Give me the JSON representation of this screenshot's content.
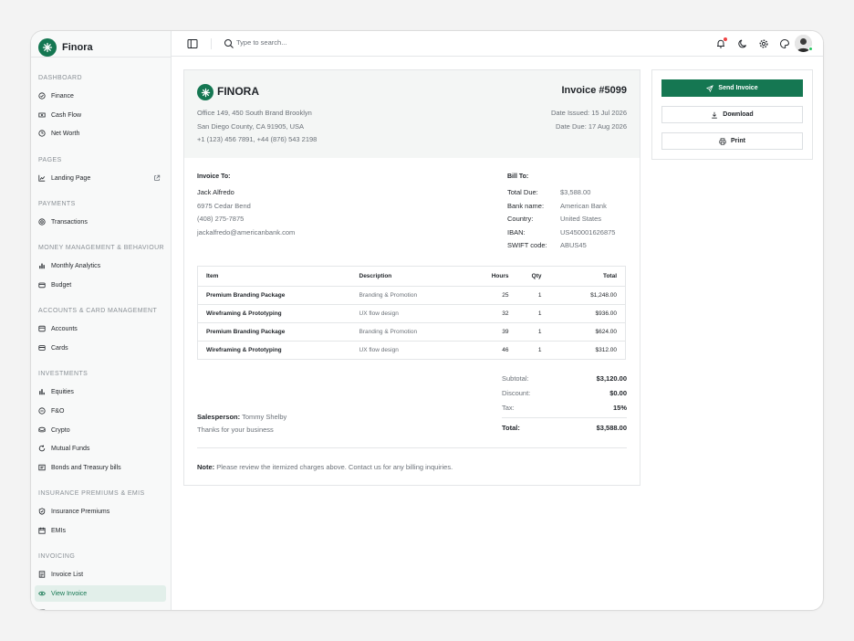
{
  "app": {
    "name": "Finora"
  },
  "sidebar": {
    "sections": {
      "dashboard": "DASHBOARD",
      "pages": "PAGES",
      "payments": "PAYMENTS",
      "money": "MONEY MANAGEMENT & BEHAVIOUR",
      "accounts": "ACCOUNTS & CARD MANAGEMENT",
      "investments": "INVESTMENTS",
      "insurance": "INSURANCE PREMIUMS & EMIS",
      "invoicing": "INVOICING"
    },
    "items": {
      "finance": "Finance",
      "cash_flow": "Cash Flow",
      "net_worth": "Net Worth",
      "landing_page": "Landing Page",
      "transactions": "Transactions",
      "monthly_analytics": "Monthly Analytics",
      "budget": "Budget",
      "accounts": "Accounts",
      "cards": "Cards",
      "equities": "Equities",
      "fo": "F&O",
      "crypto": "Crypto",
      "mutual_funds": "Mutual Funds",
      "bonds": "Bonds and Treasury bills",
      "insurance_premiums": "Insurance Premiums",
      "emis": "EMIs",
      "invoice_list": "Invoice List",
      "view_invoice": "View Invoice"
    },
    "active": "View Invoice"
  },
  "topbar": {
    "search_placeholder": "Type to search..."
  },
  "invoice": {
    "company": "FINORA",
    "number": "Invoice #5099",
    "address": [
      "Office 149, 450 South Brand Brooklyn",
      "San Diego County, CA 91905, USA",
      "+1 (123) 456 7891, +44 (876) 543 2198"
    ],
    "date_issued": "Date Issued: 15 Jul 2026",
    "date_due": "Date Due: 17 Aug 2026",
    "invoice_to": {
      "label": "Invoice To:",
      "name": "Jack Alfredo",
      "street": "6975 Cedar Bend",
      "phone": "(408) 275-7875",
      "email": "jackalfredo@americanbank.com"
    },
    "bill_to": {
      "label": "Bill To:",
      "rows": [
        {
          "k": "Total Due:",
          "v": "$3,588.00"
        },
        {
          "k": "Bank name:",
          "v": "American Bank"
        },
        {
          "k": "Country:",
          "v": "United States"
        },
        {
          "k": "IBAN:",
          "v": "US450001626875"
        },
        {
          "k": "SWIFT code:",
          "v": "ABUS45"
        }
      ]
    },
    "table": {
      "headers": {
        "item": "Item",
        "description": "Description",
        "hours": "Hours",
        "qty": "Qty",
        "total": "Total"
      },
      "rows": [
        {
          "item": "Premium Branding Package",
          "description": "Branding & Promotion",
          "hours": "25",
          "qty": "1",
          "total": "$1,248.00"
        },
        {
          "item": "Wireframing & Prototyping",
          "description": "UX flow design",
          "hours": "32",
          "qty": "1",
          "total": "$936.00"
        },
        {
          "item": "Premium Branding Package",
          "description": "Branding & Promotion",
          "hours": "39",
          "qty": "1",
          "total": "$624.00"
        },
        {
          "item": "Wireframing & Prototyping",
          "description": "UX flow design",
          "hours": "46",
          "qty": "1",
          "total": "$312.00"
        }
      ]
    },
    "salesperson_label": "Salesperson:",
    "salesperson": "Tommy Shelby",
    "thanks": "Thanks for your business",
    "summary": {
      "subtotal_label": "Subtotal:",
      "subtotal": "$3,120.00",
      "discount_label": "Discount:",
      "discount": "$0.00",
      "tax_label": "Tax:",
      "tax": "15%",
      "total_label": "Total:",
      "total": "$3,588.00"
    },
    "note_label": "Note:",
    "note": "Please review the itemized charges above. Contact us for any billing inquiries."
  },
  "actions": {
    "send": "Send Invoice",
    "download": "Download",
    "print": "Print"
  },
  "colors": {
    "brand": "#157752",
    "active_bg": "#e2efea",
    "notification": "#ef4444",
    "online": "#22c55e"
  }
}
